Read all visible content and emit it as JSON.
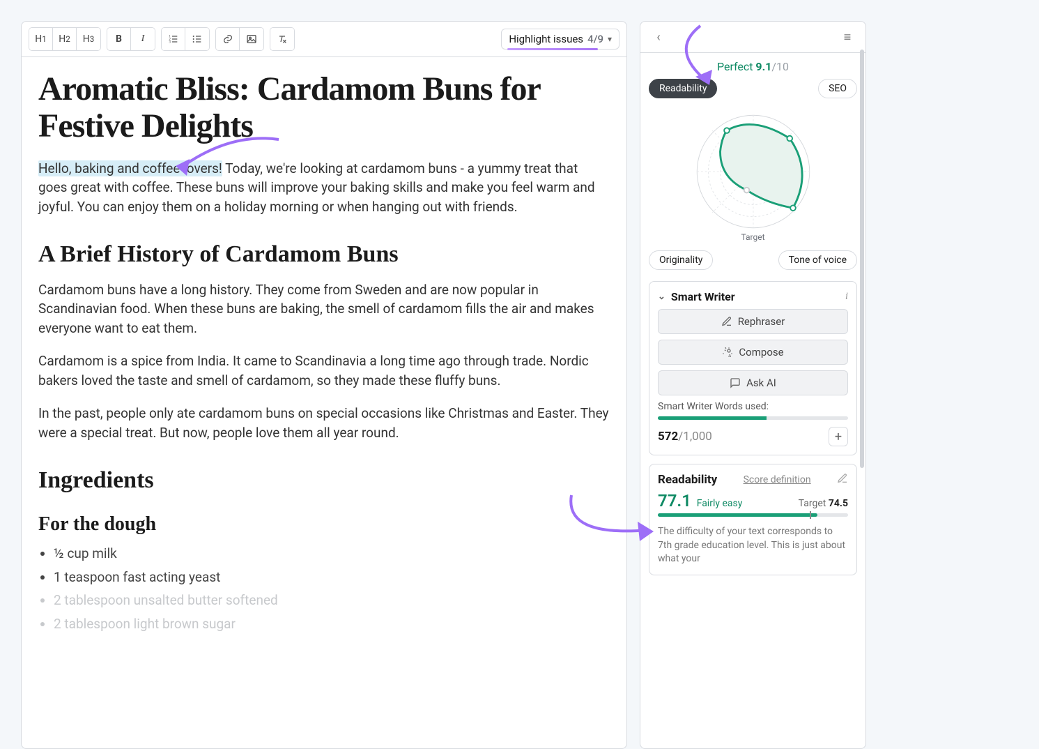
{
  "toolbar": {
    "highlight_label": "Highlight issues",
    "highlight_count": "4/9"
  },
  "doc": {
    "title": "Aromatic Bliss: Cardamom Buns for Festive Delights",
    "intro_hl": "Hello, baking and coffee lovers!",
    "intro_rest": " Today, we're looking at cardamom buns - a yummy treat that goes great with coffee. These buns will improve your baking skills and make you feel warm and joyful. You can enjoy them on a holiday morning or when hanging out with friends.",
    "h_history": "A Brief History of Cardamom Buns",
    "p_hist1": "Cardamom buns have a long history. They come from Sweden and are now popular in Scandinavian food. When these buns are baking, the smell of cardamom fills the air and makes everyone want to eat them.",
    "p_hist2": "Cardamom is a spice from India. It came to Scandinavia a long time ago through trade. Nordic bakers loved the taste and smell of cardamom, so they made these fluffy buns.",
    "p_hist3": "In the past, people only ate cardamom buns on special occasions like Christmas and Easter. They were a special treat. But now, people love them all year round.",
    "h_ing": "Ingredients",
    "h_dough": "For the dough",
    "ingredients": [
      "½ cup milk",
      "1 teaspoon fast acting yeast",
      "2 tablespoon unsalted butter softened",
      "2 tablespoon light brown sugar"
    ]
  },
  "side": {
    "score_label": "Perfect",
    "score_val": "9.1",
    "score_den": "/10",
    "tab_readability": "Readability",
    "tab_seo": "SEO",
    "tab_originality": "Originality",
    "tab_tone": "Tone of voice",
    "target_label": "Target",
    "smart_title": "Smart Writer",
    "btn_rephraser": "Rephraser",
    "btn_compose": "Compose",
    "btn_ask": "Ask AI",
    "words_label": "Smart Writer Words used:",
    "words_used": "572",
    "words_total": "/1,000",
    "words_pct": 57,
    "read_title": "Readability",
    "score_def": "Score definition",
    "read_score": "77.1",
    "read_label": "Fairly easy",
    "read_target_label": "Target",
    "read_target_val": "74.5",
    "read_pct": 84,
    "read_tick": 80,
    "read_desc": "The difficulty of your text corresponds to 7th grade education level. This is just about what your"
  }
}
